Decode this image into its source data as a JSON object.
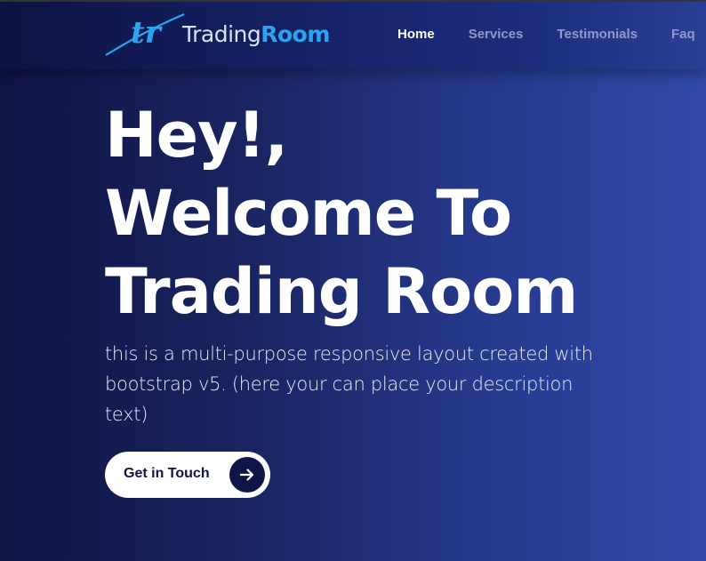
{
  "brand": {
    "name_part1": "Trading",
    "name_part2": "Room",
    "mark_letters": "tr",
    "color_primary": "#2aa4f0"
  },
  "nav": {
    "items": [
      {
        "label": "Home",
        "active": true
      },
      {
        "label": "Services",
        "active": false
      },
      {
        "label": "Testimonials",
        "active": false
      },
      {
        "label": "Faq",
        "active": false
      }
    ]
  },
  "hero": {
    "title_line1": "Hey!,",
    "title_line2": "Welcome To",
    "title_line3": "Trading Room",
    "description": "this is a multi-purpose responsive layout created with bootstrap v5. (here your can place your description text)",
    "cta_label": "Get in Touch",
    "cta_icon": "arrow-right-icon"
  },
  "colors": {
    "background_dark": "#0f1443",
    "background_light": "#3049a8",
    "text_white": "#ffffff",
    "nav_muted": "#8f9ac8"
  }
}
